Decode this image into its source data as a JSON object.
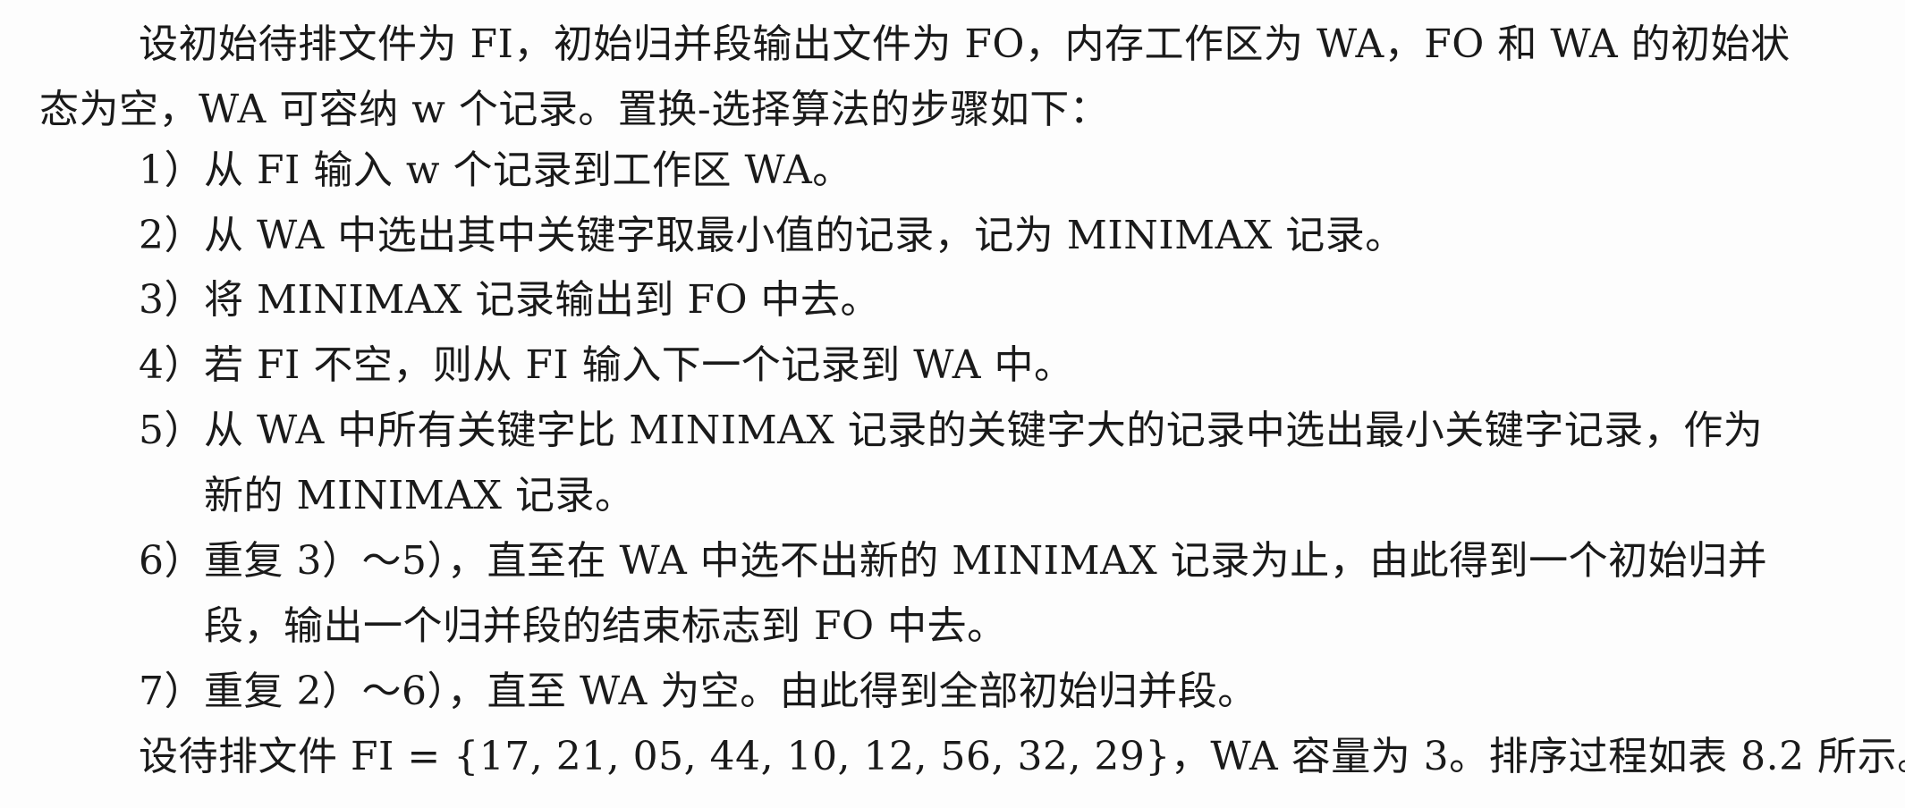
{
  "document": {
    "intro_line1": "设初始待排文件为 FI，初始归并段输出文件为 FO，内存工作区为 WA，FO 和 WA 的初始状",
    "intro_line2": "态为空，WA 可容纳 w 个记录。置换-选择算法的步骤如下：",
    "step1": "1）从 FI 输入 w 个记录到工作区 WA。",
    "step2": "2）从 WA 中选出其中关键字取最小值的记录，记为 MINIMAX 记录。",
    "step3": "3）将 MINIMAX 记录输出到 FO 中去。",
    "step4": "4）若 FI 不空，则从 FI 输入下一个记录到 WA 中。",
    "step5_line1": "5）从 WA 中所有关键字比 MINIMAX 记录的关键字大的记录中选出最小关键字记录，作为",
    "step5_line2": "新的 MINIMAX 记录。",
    "step6_line1": "6）重复 3）～5），直至在 WA 中选不出新的 MINIMAX 记录为止，由此得到一个初始归并",
    "step6_line2": "段，输出一个归并段的结束标志到 FO 中去。",
    "step7": "7）重复 2）～6），直至 WA 为空。由此得到全部初始归并段。",
    "example": "设待排文件 FI = {17, 21, 05, 44, 10, 12, 56, 32, 29}，WA 容量为 3。排序过程如表 8.2 所示。"
  }
}
